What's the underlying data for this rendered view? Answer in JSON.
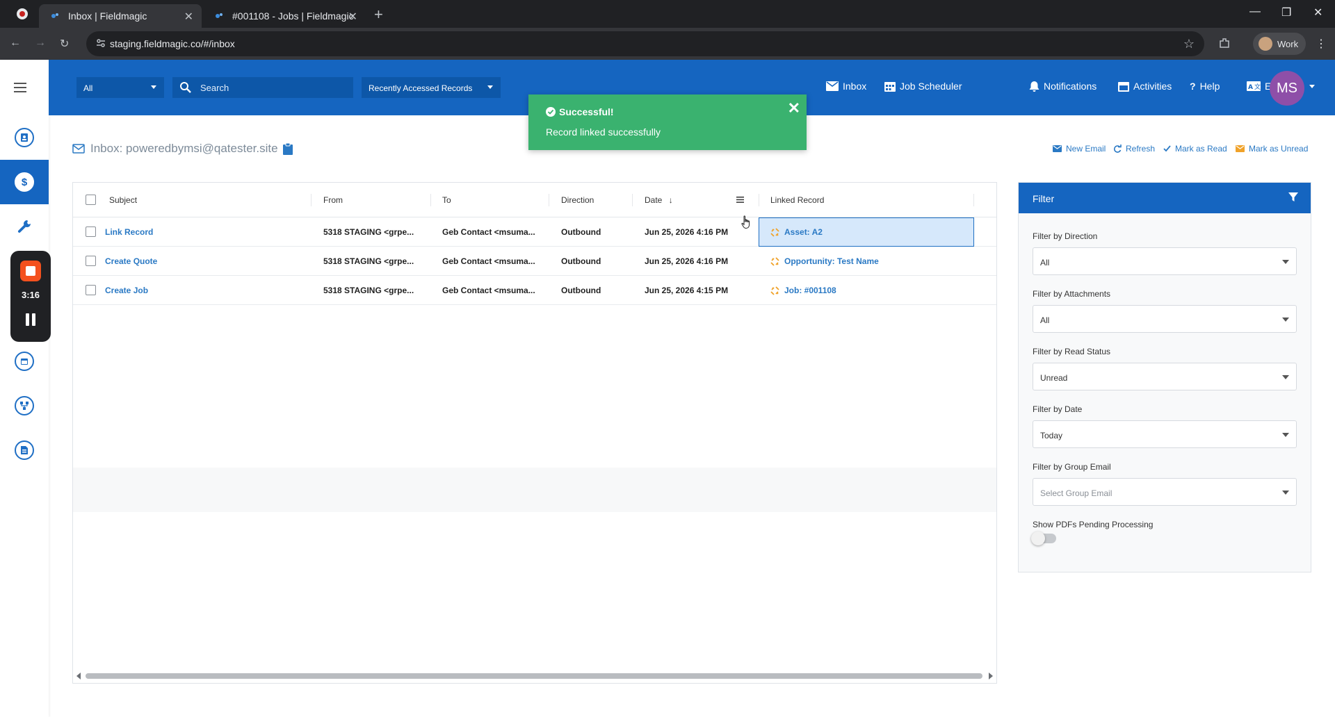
{
  "browser": {
    "tabs": [
      {
        "title": "Inbox | Fieldmagic",
        "active": true
      },
      {
        "title": "#001108 - Jobs | Fieldmagic",
        "active": false
      }
    ],
    "url": "staging.fieldmagic.co/#/inbox",
    "profile_label": "Work"
  },
  "recorder": {
    "time": "3:16"
  },
  "header": {
    "scope_value": "All",
    "search_placeholder": "Search",
    "recent_label": "Recently Accessed Records",
    "nav": {
      "inbox": "Inbox",
      "job_scheduler": "Job Scheduler",
      "notifications": "Notifications",
      "activities": "Activities",
      "help": "Help",
      "language": "EN"
    },
    "avatar_initials": "MS",
    "colors": {
      "primary": "#1565c0",
      "avatar": "#8e4fa8"
    }
  },
  "toast": {
    "title": "Successful!",
    "message": "Record linked successfully",
    "color": "#3ab26f"
  },
  "inbox": {
    "title": "Inbox: poweredbymsi@qatester.site",
    "actions": {
      "new_email": "New Email",
      "refresh": "Refresh",
      "mark_read": "Mark as Read",
      "mark_unread": "Mark as Unread"
    },
    "columns": [
      "Subject",
      "From",
      "To",
      "Direction",
      "Date",
      "Linked Record"
    ],
    "rows": [
      {
        "subject": "Link Record",
        "from": "5318 STAGING <grpe...",
        "to": "Geb Contact <msuma...",
        "direction": "Outbound",
        "date": "Jun 25, 2026 4:16 PM",
        "linked": "Asset: A2",
        "selected": true
      },
      {
        "subject": "Create Quote",
        "from": "5318 STAGING <grpe...",
        "to": "Geb Contact <msuma...",
        "direction": "Outbound",
        "date": "Jun 25, 2026 4:16 PM",
        "linked": "Opportunity: Test Name",
        "selected": false
      },
      {
        "subject": "Create Job",
        "from": "5318 STAGING <grpe...",
        "to": "Geb Contact <msuma...",
        "direction": "Outbound",
        "date": "Jun 25, 2026 4:15 PM",
        "linked": "Job: #001108",
        "selected": false
      }
    ]
  },
  "filter": {
    "title": "Filter",
    "direction": {
      "label": "Filter by Direction",
      "value": "All"
    },
    "attachments": {
      "label": "Filter by Attachments",
      "value": "All"
    },
    "read_status": {
      "label": "Filter by Read Status",
      "value": "Unread"
    },
    "date": {
      "label": "Filter by Date",
      "value": "Today"
    },
    "group_email": {
      "label": "Filter by Group Email",
      "placeholder": "Select Group Email"
    },
    "pdfs_label": "Show PDFs Pending Processing",
    "pdfs_enabled": false
  }
}
